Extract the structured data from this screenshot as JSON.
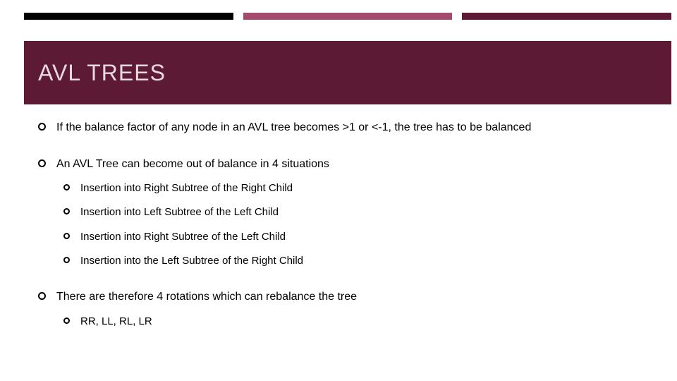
{
  "title": "AVL TREES",
  "bullets": [
    {
      "text": "If the balance factor of any node in an AVL tree becomes >1 or <-1, the tree has to be balanced",
      "children": []
    },
    {
      "text": "An AVL Tree can become out of balance in 4 situations",
      "children": [
        "Insertion into Right Subtree of the Right Child",
        "Insertion into Left Subtree of the Left Child",
        "Insertion into Right Subtree of the Left Child",
        "Insertion into the Left Subtree of the Right Child"
      ]
    },
    {
      "text": "There are therefore 4 rotations which can rebalance the tree",
      "children": [
        "RR, LL, RL, LR"
      ]
    }
  ],
  "colors": {
    "ribbon_black": "#000000",
    "ribbon_mauve": "#a44a6d",
    "title_band": "#5c1a34",
    "title_text": "#e8d9df"
  }
}
